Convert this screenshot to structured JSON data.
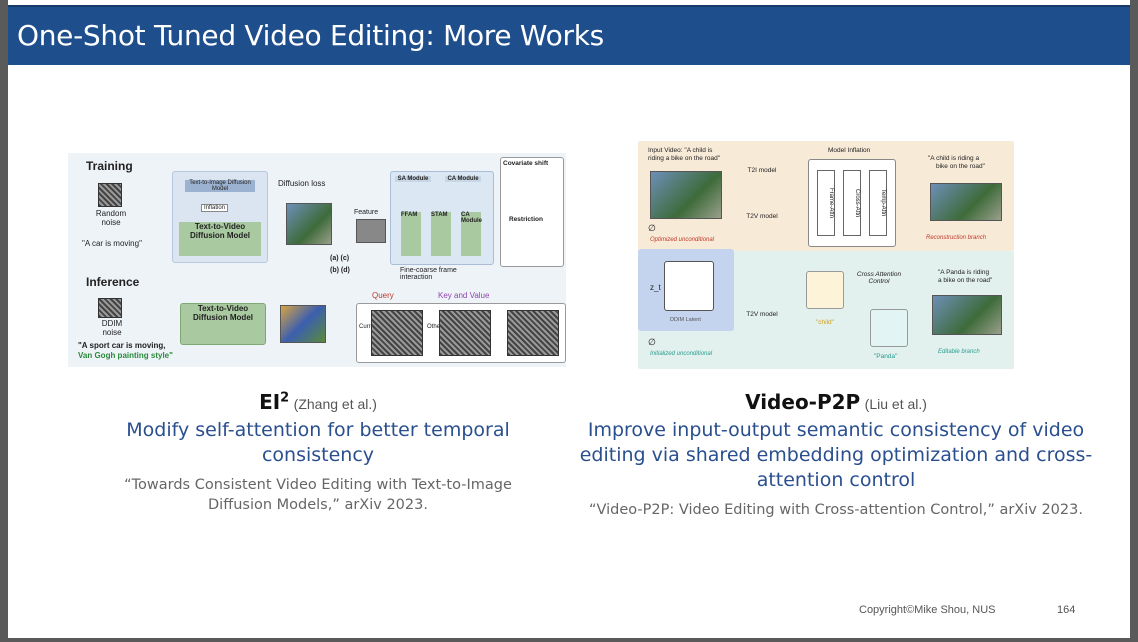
{
  "slide": {
    "title": "One-Shot Tuned Video Editing: More Works",
    "footer": {
      "copyright": "Copyright©Mike Shou, NUS",
      "page": "164"
    }
  },
  "left_work": {
    "name": "EI",
    "name_sup": "2",
    "authors": "(Zhang et al.)",
    "summary": "Modify self-attention for better temporal consistency",
    "citation": "“Towards Consistent Video Editing with Text-to-Image Diffusion Models,” arXiv 2023.",
    "figure": {
      "training": "Training",
      "inference": "Inference",
      "random_noise": "Random noise",
      "prompt1": "\"A car is moving\"",
      "t2i": "Text-to-Image Diffusion Model",
      "inflation": "Inflation",
      "t2v": "Text-to-Video Diffusion Model",
      "diffusion_loss": "Diffusion loss",
      "ddim_noise": "DDIM noise",
      "prompt2_a": "\"A sport car is moving,",
      "prompt2_b": "Van Gogh painting style\"",
      "sa_module": "SA Module",
      "ca_module": "CA Module",
      "feature": "Feature",
      "ffam": "FFAM",
      "stam": "STAM",
      "ca": "CA Module",
      "covariate": "Covariate shift",
      "restriction": "Restriction",
      "fine_coarse": "Fine-coarse frame interaction",
      "query": "Query",
      "key_value": "Key and Value",
      "current": "Current",
      "others": "Others",
      "ac": "(a) (c)",
      "bd": "(b) (d)"
    }
  },
  "right_work": {
    "name": "Video-P2P",
    "authors": "(Liu et al.)",
    "summary": "Improve input-output semantic consistency of video editing via shared embedding optimization and cross-attention control",
    "citation": "“Video-P2P: Video Editing with Cross-attention Control,” arXiv 2023.",
    "figure": {
      "input_video_a": "Input Video: \"A child is",
      "input_video_b": "riding a bike on the road\"",
      "t2i_model": "T2I model",
      "t2v_model": "T2V model",
      "model_inflation": "Model Inflation",
      "frame_attn": "Frame-Attn",
      "cross_attn": "Cross-Attn",
      "temp_attn": "Temp-Attn",
      "out1_a": "\"A child is riding a",
      "out1_b": "bike on the road\"",
      "reconstruction": "Reconstruction branch",
      "optimized": "Optimized unconditional",
      "ddim_latent": "DDIM Latent",
      "zt": "z_t",
      "cross_attention_control": "Cross Attention Control",
      "child": "\"child\"",
      "panda": "\"Panda\"",
      "out2_a": "\"A Panda is riding",
      "out2_b": "a bike on the road\"",
      "editable": "Editable branch",
      "initialized": "Initialized unconditional",
      "phi": "∅"
    }
  }
}
